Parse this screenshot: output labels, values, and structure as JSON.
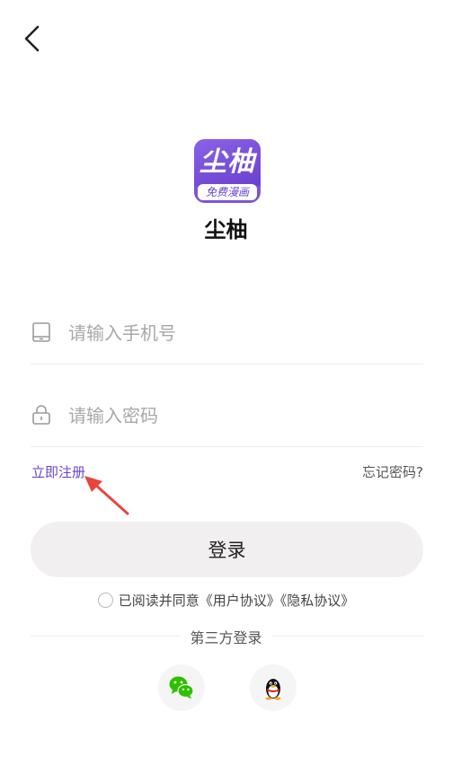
{
  "app": {
    "name": "尘柚",
    "logo_text": "尘柚",
    "logo_sub": "免费漫画"
  },
  "form": {
    "phone_placeholder": "请输入手机号",
    "password_placeholder": "请输入密码",
    "register_label": "立即注册",
    "forgot_label": "忘记密码?",
    "login_label": "登录"
  },
  "agreement": {
    "prefix": "已阅读并同意",
    "user_agreement": "《用户协议》",
    "privacy_agreement": "《隐私协议》"
  },
  "third_party": {
    "label": "第三方登录",
    "providers": [
      "wechat-icon",
      "qq-icon"
    ]
  },
  "colors": {
    "accent": "#6a45c9",
    "button_bg": "#f1eff0",
    "annotation_arrow": "#e8453c",
    "wechat": "#2dc100"
  }
}
